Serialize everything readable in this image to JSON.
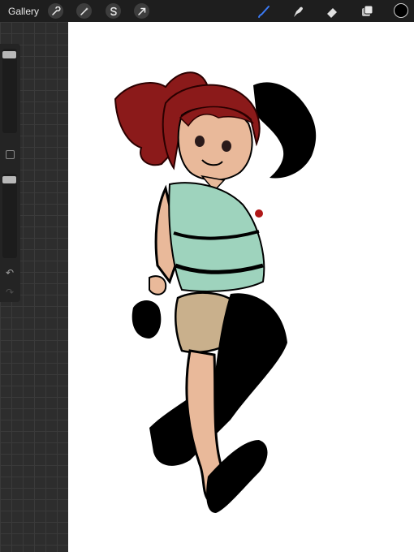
{
  "topbar": {
    "gallery_label": "Gallery",
    "left_tools": [
      "wrench-icon",
      "magic-wand-icon",
      "selection-s-icon",
      "arrow-cursor-icon"
    ],
    "right_tools": [
      "brush-icon",
      "smudge-icon",
      "eraser-icon",
      "layers-icon"
    ],
    "active_tool": "brush-icon",
    "active_tool_color": "#3b7bf5",
    "current_color": "#000000"
  },
  "sidebar": {
    "brush_size_slider": 0.95,
    "opacity_slider": 0.95,
    "controls": [
      "modify-square-icon",
      "undo-icon",
      "redo-icon"
    ]
  },
  "canvas": {
    "background": "#ffffff",
    "artwork": "character-sketch",
    "colors": {
      "hair": "#8b1a1a",
      "skin": "#e9b99a",
      "top": "#9ed3bd",
      "shorts": "#c9b08c",
      "ink": "#000000"
    }
  }
}
